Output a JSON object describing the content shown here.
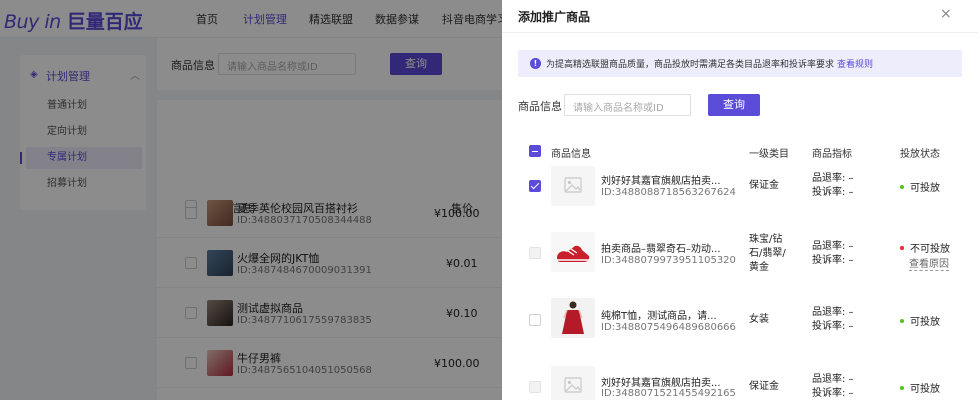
{
  "logo": {
    "brand": "Buy in",
    "cn": "巨量百应"
  },
  "nav": [
    {
      "label": "首页"
    },
    {
      "label": "计划管理"
    },
    {
      "label": "精选联盟"
    },
    {
      "label": "数据参谋"
    },
    {
      "label": "抖音电商学习"
    }
  ],
  "sidebar": {
    "group_label": "计划管理",
    "items": [
      {
        "label": "普通计划"
      },
      {
        "label": "定向计划"
      },
      {
        "label": "专属计划"
      },
      {
        "label": "招募计划"
      }
    ]
  },
  "main": {
    "filter_label": "商品信息",
    "search_placeholder": "请输入商品名称或ID",
    "search_button": "查询",
    "columns": {
      "product": "商品信息",
      "price": "售价"
    },
    "rows": [
      {
        "name": "夏季英伦校园风百搭衬衫",
        "id": "ID:3488037170508344488",
        "price": "¥100.00"
      },
      {
        "name": "火爆全网的JKT恤",
        "id": "ID:3487484670009031391",
        "price": "¥0.01"
      },
      {
        "name": "测试虚拟商品",
        "id": "ID:3487710617559783835",
        "price": "¥0.10"
      },
      {
        "name": "牛仔男裤",
        "id": "ID:3487565104051050568",
        "price": "¥100.00"
      }
    ]
  },
  "drawer": {
    "title": "添加推广商品",
    "close": "×",
    "notice": "为提高精选联盟商品质量，商品投放时需满足各类目品退率和投诉率要求",
    "notice_link": "查看规则",
    "filter_label": "商品信息",
    "search_placeholder": "请输入商品名称或ID",
    "search_button": "查询",
    "columns": {
      "product": "商品信息",
      "category": "一级类目",
      "metrics": "商品指标",
      "status": "投放状态"
    },
    "rows": [
      {
        "name": "刘好好其嘉官旗舰店拍卖...",
        "id": "ID:3488088718563267624",
        "category": "保证金",
        "return_rate": "品退率: –",
        "complaint_rate": "投诉率: –",
        "status": "可投放",
        "status_color": "#52c41a",
        "link": ""
      },
      {
        "name": "拍卖商品–翡翠奇石–劝动...",
        "id": "ID:3488079973951105320",
        "category": "珠宝/钻石/翡翠/黄金",
        "return_rate": "品退率: –",
        "complaint_rate": "投诉率: –",
        "status": "不可投放",
        "status_color": "#f5222d",
        "link": "查看原因"
      },
      {
        "name": "纯棉T恤，测试商品，请...",
        "id": "ID:3488075496489680666",
        "category": "女装",
        "return_rate": "品退率: –",
        "complaint_rate": "投诉率: –",
        "status": "可投放",
        "status_color": "#52c41a",
        "link": ""
      },
      {
        "name": "刘好好其嘉官旗舰店拍卖...",
        "id": "ID:3488071521455492165",
        "category": "保证金",
        "return_rate": "品退率: –",
        "complaint_rate": "投诉率: –",
        "status": "可投放",
        "status_color": "#52c41a",
        "link": ""
      }
    ]
  },
  "colors": {
    "accent": "#5a4bd9",
    "ok": "#52c41a",
    "error": "#f5222d"
  }
}
